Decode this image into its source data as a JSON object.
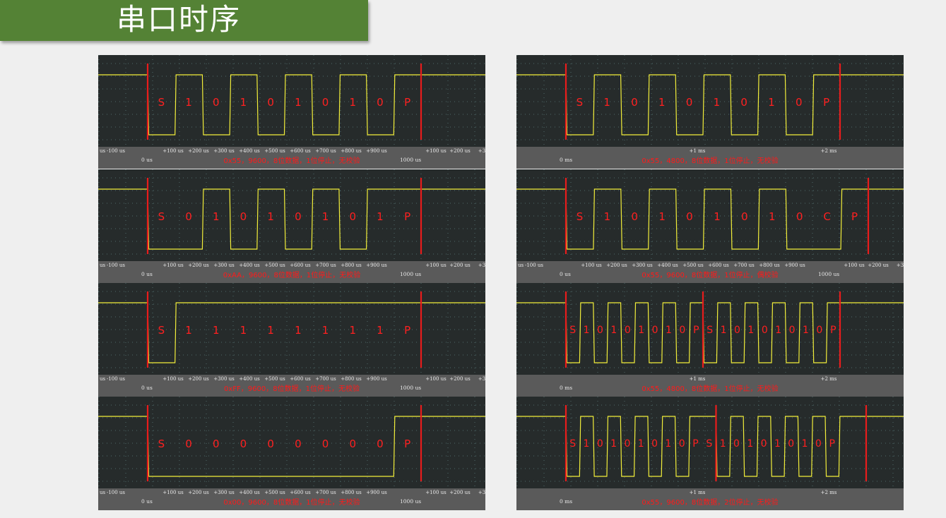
{
  "page": {
    "title": "串口时序"
  },
  "colors": {
    "title_bar": "#548235",
    "scope_bg": "#262b2b",
    "signal": "#f2ee3a",
    "marker": "#e81c1c",
    "axis_bg": "#5a5a5a"
  },
  "panels": [
    {
      "id": "p1",
      "caption": "0x55，9600，8位数据，1位停止，无校验",
      "labels": [
        "S",
        "1",
        "0",
        "1",
        "0",
        "1",
        "0",
        "1",
        "0",
        "P"
      ],
      "ticks": [
        "us",
        "-100 us",
        "+100 us",
        "+200 us",
        "+300 us",
        "+400 us",
        "+500 us",
        "+600 us",
        "+700 us",
        "+800 us",
        "+900 us",
        "+100 us",
        "+200 us",
        "+3"
      ],
      "origin": "0 us",
      "end": "1000 us",
      "signal_bits": [
        0,
        1,
        0,
        1,
        0,
        1,
        0,
        1,
        0,
        1
      ],
      "marker_bits": [
        0,
        10
      ]
    },
    {
      "id": "p2",
      "caption": "0xAA，9600，8位数据，1位停止，无校验",
      "labels": [
        "S",
        "0",
        "1",
        "0",
        "1",
        "0",
        "1",
        "0",
        "1",
        "P"
      ],
      "ticks": [
        "us",
        "-100 us",
        "+100 us",
        "+200 us",
        "+300 us",
        "+400 us",
        "+500 us",
        "+600 us",
        "+700 us",
        "+800 us",
        "+900 us",
        "+100 us",
        "+200 us",
        "+3"
      ],
      "origin": "0 us",
      "end": "1000 us",
      "signal_bits": [
        0,
        0,
        1,
        0,
        1,
        0,
        1,
        0,
        1,
        1
      ],
      "marker_bits": [
        0,
        10
      ]
    },
    {
      "id": "p3",
      "caption": "0xFF，9600，8位数据，1位停止，无校验",
      "labels": [
        "S",
        "1",
        "1",
        "1",
        "1",
        "1",
        "1",
        "1",
        "1",
        "P"
      ],
      "ticks": [
        "us",
        "-100 us",
        "+100 us",
        "+200 us",
        "+300 us",
        "+400 us",
        "+500 us",
        "+600 us",
        "+700 us",
        "+800 us",
        "+900 us",
        "+100 us",
        "+200 us",
        "+3"
      ],
      "origin": "0 us",
      "end": "1000 us",
      "signal_bits": [
        0,
        1,
        1,
        1,
        1,
        1,
        1,
        1,
        1,
        1
      ],
      "marker_bits": [
        0,
        10
      ]
    },
    {
      "id": "p4",
      "caption": "0x00，9600，8位数据，1位停止，无校验",
      "labels": [
        "S",
        "0",
        "0",
        "0",
        "0",
        "0",
        "0",
        "0",
        "0",
        "P"
      ],
      "ticks": [
        "us",
        "-100 us",
        "+100 us",
        "+200 us",
        "+300 us",
        "+400 us",
        "+500 us",
        "+600 us",
        "+700 us",
        "+800 us",
        "+900 us",
        "+100 us",
        "+200 us",
        "+3"
      ],
      "origin": "0 us",
      "end": "1000 us",
      "signal_bits": [
        0,
        0,
        0,
        0,
        0,
        0,
        0,
        0,
        0,
        1
      ],
      "marker_bits": [
        0,
        10
      ]
    },
    {
      "id": "p5",
      "caption": "0x55，4800，8位数据，1位停止，无校验",
      "labels": [
        "S",
        "1",
        "0",
        "1",
        "0",
        "1",
        "0",
        "1",
        "0",
        "P"
      ],
      "ticks": [
        "+1 ms",
        "+2 ms"
      ],
      "origin": "0 ms",
      "end": "",
      "signal_bits": [
        0,
        1,
        0,
        1,
        0,
        1,
        0,
        1,
        0,
        1
      ],
      "marker_bits": [
        0,
        10
      ]
    },
    {
      "id": "p6",
      "caption": "0x55，9600，8位数据，1位停止，偶校验",
      "labels": [
        "S",
        "1",
        "0",
        "1",
        "0",
        "1",
        "0",
        "1",
        "0",
        "C",
        "P"
      ],
      "ticks": [
        "us",
        "-100 us",
        "+100 us",
        "+200 us",
        "+300 us",
        "+400 us",
        "+500 us",
        "+600 us",
        "+700 us",
        "+800 us",
        "+900 us",
        "+100 us",
        "+200 us",
        "+3"
      ],
      "origin": "0 us",
      "end": "1000 us",
      "signal_bits": [
        0,
        1,
        0,
        1,
        0,
        1,
        0,
        1,
        0,
        0,
        1
      ],
      "marker_bits": [
        0,
        11
      ]
    },
    {
      "id": "p7",
      "caption": "0x55，4800，8位数据，1位停止，无校验",
      "labels": [
        "S",
        "1",
        "0",
        "1",
        "0",
        "1",
        "0",
        "1",
        "0",
        "P",
        "S",
        "1",
        "0",
        "1",
        "0",
        "1",
        "0",
        "1",
        "0",
        "P"
      ],
      "ticks": [
        "+1 ms",
        "+2 ms"
      ],
      "origin": "0 ms",
      "end": "",
      "signal_bits": [
        0,
        1,
        0,
        1,
        0,
        1,
        0,
        1,
        0,
        1,
        0,
        1,
        0,
        1,
        0,
        1,
        0,
        1,
        0,
        1
      ],
      "marker_bits": [
        0,
        10,
        20
      ]
    },
    {
      "id": "p8",
      "caption": "0x55，9600，8位数据，2位停止，无校验",
      "labels": [
        "S",
        "1",
        "0",
        "1",
        "0",
        "1",
        "0",
        "1",
        "0",
        "P",
        "S",
        "1",
        "0",
        "1",
        "0",
        "1",
        "0",
        "1",
        "0",
        "P"
      ],
      "ticks": [
        "+1 ms",
        "+2 ms"
      ],
      "origin": "0 ms",
      "end": "",
      "signal_bits": [
        0,
        1,
        0,
        1,
        0,
        1,
        0,
        1,
        0,
        1,
        1,
        0,
        1,
        0,
        1,
        0,
        1,
        0,
        1,
        0,
        1,
        1
      ],
      "marker_bits": [
        0,
        11,
        22
      ]
    }
  ]
}
